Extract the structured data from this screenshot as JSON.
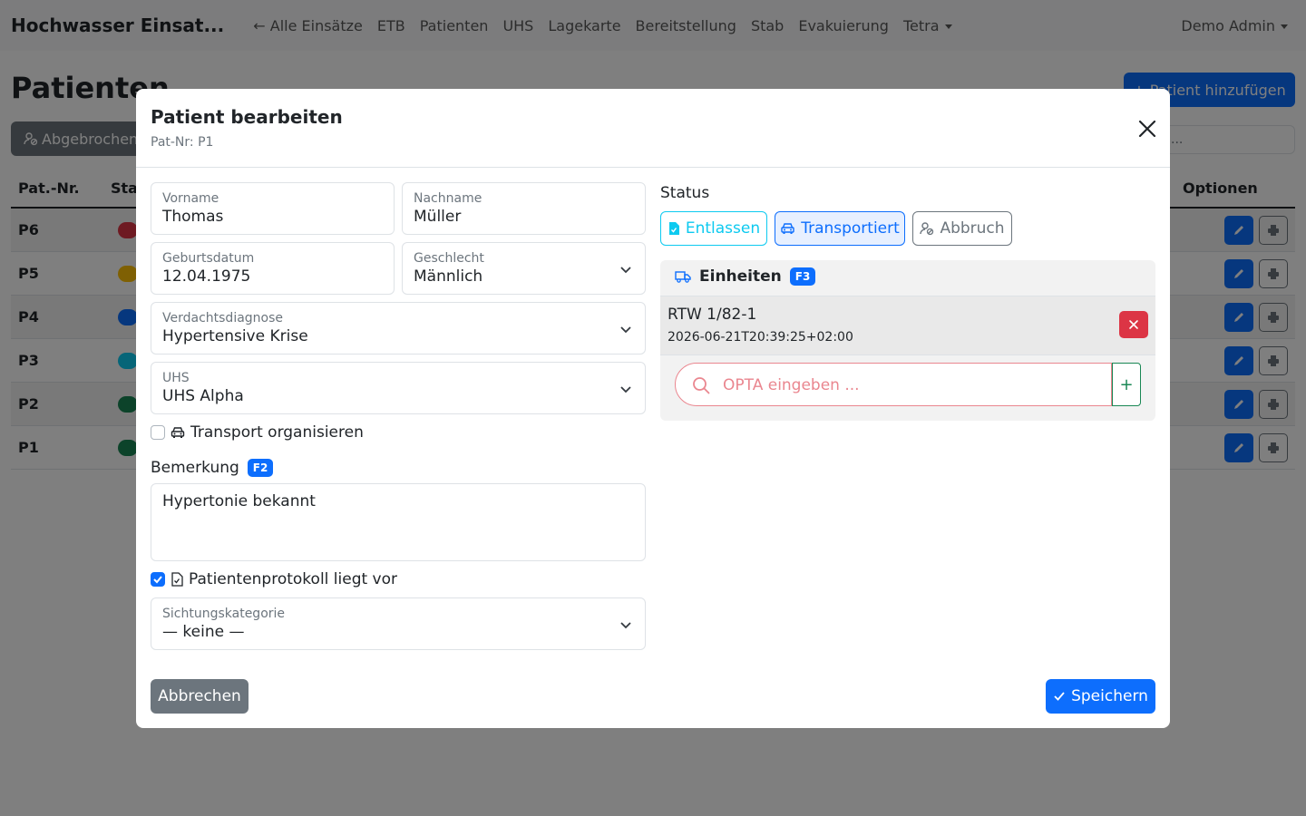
{
  "navbar": {
    "brand": "Hochwasser Einsat...",
    "links": [
      "← Alle Einsätze",
      "ETB",
      "Patienten",
      "UHS",
      "Lagekarte",
      "Bereitstellung",
      "Stab",
      "Evakuierung",
      "Tetra"
    ],
    "user": "Demo Admin"
  },
  "page": {
    "title": "Patienten",
    "add_button": "+ Patient hinzufügen",
    "filter_button": "Abgebrochen",
    "search_placeholder": "..."
  },
  "table": {
    "headers": {
      "nr": "Pat.-Nr.",
      "status": "Sta",
      "options": "Optionen"
    },
    "rows": [
      {
        "nr": "P6",
        "badge_color": "#dc3545"
      },
      {
        "nr": "P5",
        "badge_color": "#ffc107"
      },
      {
        "nr": "P4",
        "badge_color": "#0d6efd"
      },
      {
        "nr": "P3",
        "badge_color": "#0dcaf0"
      },
      {
        "nr": "P2",
        "badge_color": "#198754"
      },
      {
        "nr": "P1",
        "badge_color": "#198754"
      }
    ]
  },
  "modal": {
    "title": "Patient bearbeiten",
    "subtitle": "Pat-Nr: P1",
    "fields": {
      "vorname": {
        "label": "Vorname",
        "value": "Thomas"
      },
      "nachname": {
        "label": "Nachname",
        "value": "Müller"
      },
      "geburtsdatum": {
        "label": "Geburtsdatum",
        "value": "12.04.1975"
      },
      "geschlecht": {
        "label": "Geschlecht",
        "value": "Männlich"
      },
      "verdachtsdiagnose": {
        "label": "Verdachtsdiagnose",
        "value": "Hypertensive Krise"
      },
      "uhs": {
        "label": "UHS",
        "value": "UHS Alpha"
      },
      "sichtung": {
        "label": "Sichtungskategorie",
        "value": "— keine —"
      }
    },
    "transport_checkbox": {
      "label": "Transport organisieren",
      "checked": false
    },
    "bemerkung": {
      "label": "Bemerkung",
      "shortcut": "F2",
      "value": "Hypertonie bekannt"
    },
    "protokoll_checkbox": {
      "label": "Patientenprotokoll liegt vor",
      "checked": true
    },
    "status": {
      "label": "Status",
      "buttons": {
        "entlassen": "Entlassen",
        "transportiert": "Transportiert",
        "abbruch": "Abbruch"
      }
    },
    "einheiten": {
      "label": "Einheiten",
      "shortcut": "F3",
      "units": [
        {
          "name": "RTW 1/82-1",
          "time": "2026-06-21T20:39:25+02:00"
        }
      ],
      "opta_placeholder": "OPTA eingeben ...",
      "add_label": "+"
    },
    "buttons": {
      "cancel": "Abbrechen",
      "save": "Speichern"
    }
  },
  "colors": {
    "primary": "#0d6efd",
    "secondary": "#6c757d",
    "danger": "#dc3545",
    "info": "#0dcaf0",
    "success": "#198754"
  }
}
